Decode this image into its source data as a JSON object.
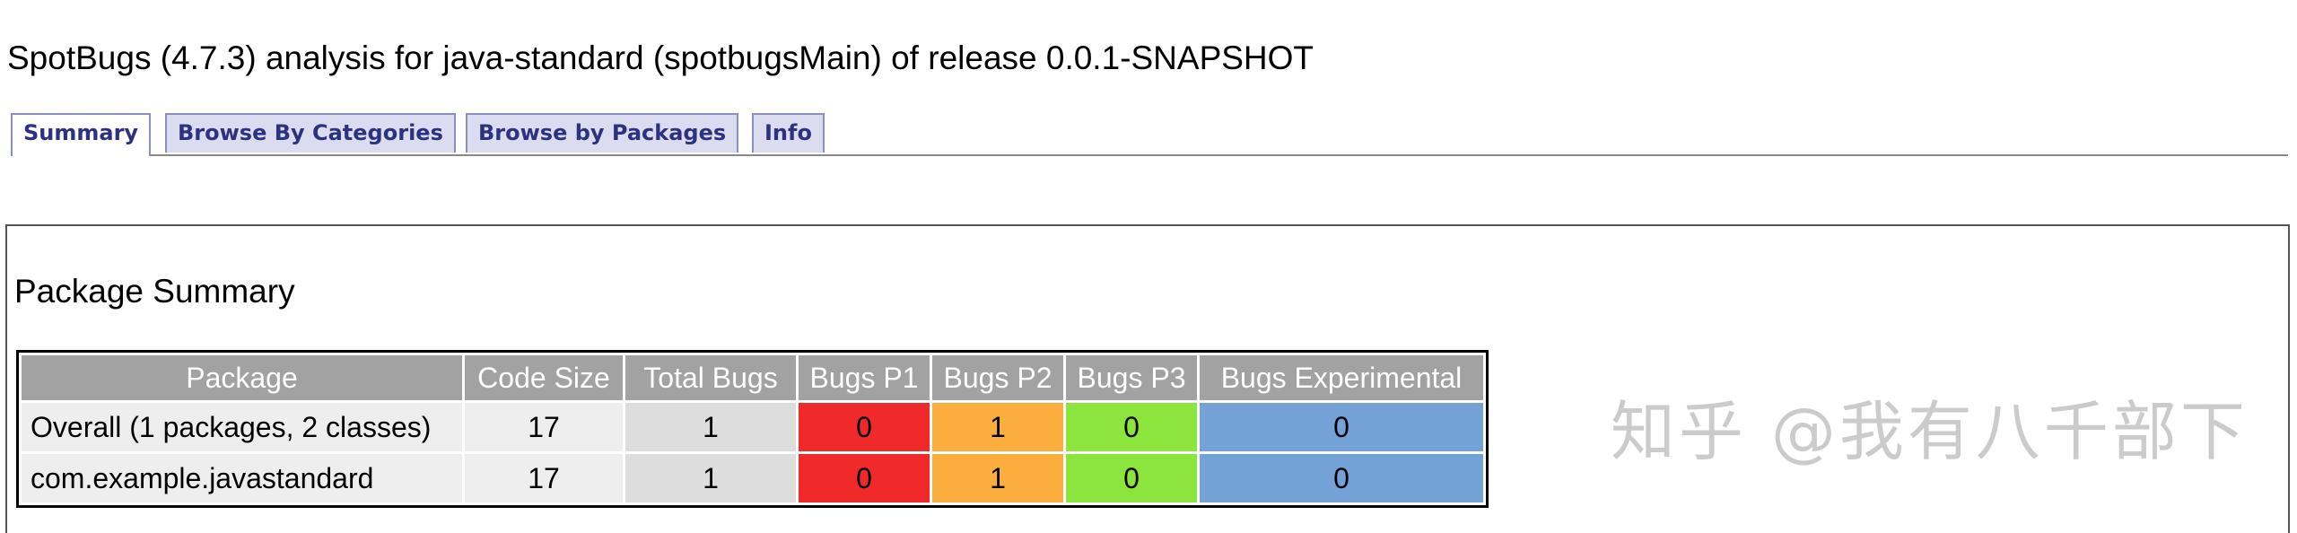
{
  "header": {
    "title": "SpotBugs (4.7.3) analysis for java-standard (spotbugsMain) of release 0.0.1-SNAPSHOT"
  },
  "tabs": [
    {
      "label": "Summary",
      "active": true
    },
    {
      "label": "Browse By Categories",
      "active": false
    },
    {
      "label": "Browse by Packages",
      "active": false
    },
    {
      "label": "Info",
      "active": false
    }
  ],
  "package_summary": {
    "title": "Package Summary",
    "columns": [
      "Package",
      "Code Size",
      "Total Bugs",
      "Bugs P1",
      "Bugs P2",
      "Bugs P3",
      "Bugs Experimental"
    ],
    "rows": [
      {
        "package": "Overall (1 packages, 2 classes)",
        "code_size": "17",
        "total_bugs": "1",
        "p1": "0",
        "p2": "1",
        "p3": "0",
        "experimental": "0"
      },
      {
        "package": "com.example.javastandard",
        "code_size": "17",
        "total_bugs": "1",
        "p1": "0",
        "p2": "1",
        "p3": "0",
        "experimental": "0"
      }
    ]
  },
  "colors": {
    "p1": "#f02a2a",
    "p2": "#fbad3e",
    "p3": "#8be53c",
    "experimental": "#74a2d6",
    "header_bg": "#a2a2a2"
  },
  "watermark": {
    "text": "知乎 @我有八千部下"
  }
}
